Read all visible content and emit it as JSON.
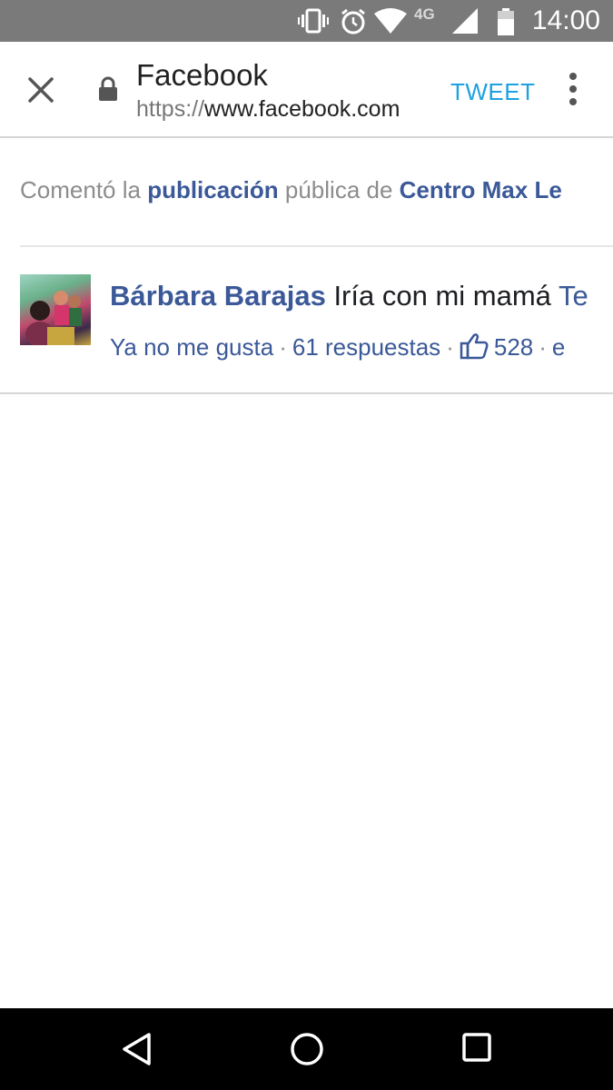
{
  "status_bar": {
    "time": "14:00",
    "network": "4G",
    "icons": [
      "vibrate-icon",
      "alarm-icon",
      "wifi-icon",
      "signal-icon",
      "battery-icon"
    ]
  },
  "toolbar": {
    "title": "Facebook",
    "url_scheme": "https://",
    "url_host": "www.facebook.com",
    "tweet_label": "TWEET"
  },
  "activity": {
    "prefix": "Comentó la ",
    "post_link": "publicación",
    "middle": " pública de ",
    "page_link": "Centro Max Le"
  },
  "comment": {
    "author": "Bárbara Barajas",
    "text": " Iría con mi mamá ",
    "text_tail": "Te",
    "unlike": "Ya no me gusta",
    "replies": "61 respuestas",
    "likes": "528",
    "tail": "e"
  },
  "colors": {
    "link": "#3b5998",
    "tweet": "#1da1e0",
    "status_bar": "#7a7a7a"
  }
}
